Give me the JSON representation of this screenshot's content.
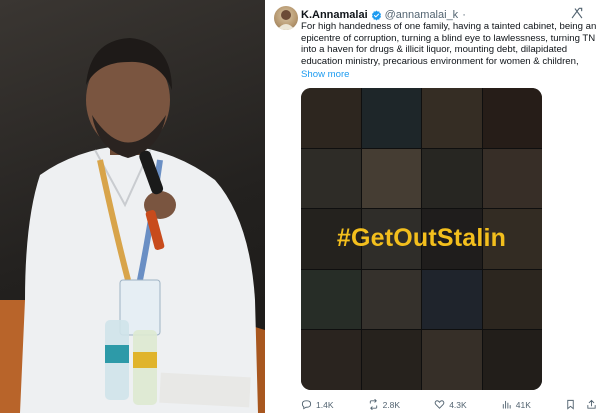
{
  "tweet": {
    "display_name": "K.Annamalai",
    "handle": "@annamalai_k",
    "more": "·",
    "text": "For high handedness of one family, having a tainted cabinet, being an epicentre of corruption, turning a blind eye to lawlessness, turning TN into a haven for drugs & illicit liquor, mounting debt, dilapidated education ministry, precarious environment for women & children,",
    "show_more": "Show more",
    "image_text": "#GetOutStalin",
    "stats": {
      "replies": "1.4K",
      "reposts": "2.8K",
      "likes": "4.3K",
      "views": "41K"
    }
  },
  "colors": {
    "link_blue": "#1d9bf0",
    "hashtag_yellow": "#f3bf1d",
    "verified_blue": "#1d9bf0",
    "muted_gray": "#536471"
  },
  "icons": [
    "verified-badge-icon",
    "grok-icon",
    "reply-icon",
    "repost-icon",
    "like-icon",
    "views-icon",
    "bookmark-icon",
    "share-icon"
  ]
}
